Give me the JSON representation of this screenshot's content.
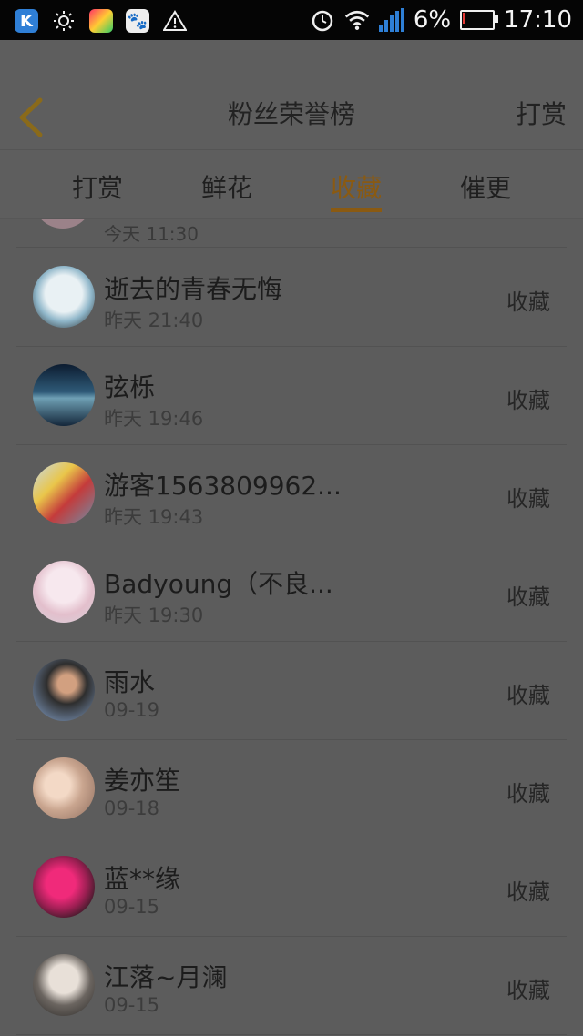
{
  "status_bar": {
    "app_icon_label": "K",
    "battery_percent_text": "6%",
    "battery_level": 0.06,
    "time": "17:10",
    "icons": [
      "k-app-icon",
      "brightness-icon",
      "shopping-bag-icon",
      "paw-icon",
      "warning-icon",
      "alarm-icon",
      "wifi-icon",
      "signal-icon",
      "battery-icon"
    ]
  },
  "header": {
    "back_icon": "chevron-left-icon",
    "title": "粉丝荣誉榜",
    "right_action": "打赏"
  },
  "tabs": [
    {
      "label": "打赏"
    },
    {
      "label": "鲜花"
    },
    {
      "label": "收藏",
      "active": true
    },
    {
      "label": "催更"
    }
  ],
  "partial_row": {
    "time": "今天 11:30"
  },
  "list": [
    {
      "name": "逝去的青春无悔",
      "time": "昨天 21:40",
      "action": "收藏"
    },
    {
      "name": "弦栎",
      "time": "昨天 19:46",
      "action": "收藏"
    },
    {
      "name": "游客1563809962...",
      "time": "昨天 19:43",
      "action": "收藏"
    },
    {
      "name": "Badyoung（不良...",
      "time": "昨天 19:30",
      "action": "收藏"
    },
    {
      "name": "雨水",
      "time": "09-19",
      "action": "收藏"
    },
    {
      "name": "姜亦笙",
      "time": "09-18",
      "action": "收藏"
    },
    {
      "name": "蓝**缘",
      "time": "09-15",
      "action": "收藏"
    },
    {
      "name": "江落~月澜",
      "time": "09-15",
      "action": "收藏"
    }
  ],
  "colors": {
    "accent": "#8a5a12",
    "overlay_bg": "#5c5c5c"
  }
}
